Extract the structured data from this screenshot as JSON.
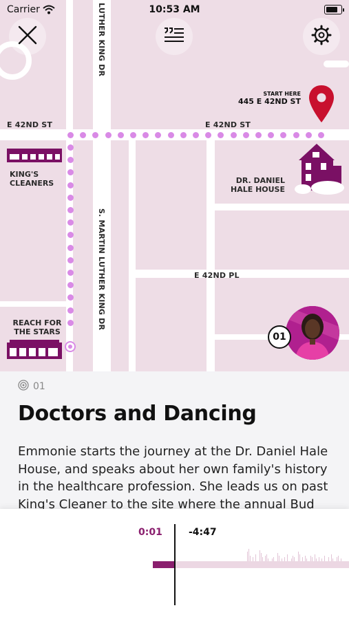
{
  "status_bar": {
    "carrier": "Carrier",
    "time": "10:53 AM"
  },
  "map": {
    "streets": {
      "e42nd_st_left": "E 42ND ST",
      "e42nd_st_right": "E 42ND ST",
      "luther_king_dr": "LUTHER KING DR",
      "s_martin_luther_king_dr": "S. MARTIN LUTHER KING DR",
      "e42nd_pl": "E 42ND PL"
    },
    "start": {
      "label": "START HERE",
      "address": "445 E 42ND ST"
    },
    "places": {
      "kings_cleaners": "KING'S CLEANERS",
      "hale_house": "DR. DANIEL HALE HOUSE",
      "reach_for_stars": "REACH FOR THE STARS"
    },
    "stop_badge": "01",
    "route_color": "#d98ae6",
    "pin_color": "#c8102e"
  },
  "buttons": {
    "close": "close-icon",
    "transcript": "transcript-icon",
    "settings": "gear-icon"
  },
  "stop": {
    "number": "01",
    "title": "Doctors and Dancing",
    "description": "Emmonie starts the journey at the Dr. Daniel Hale House, and speaks about her own family's history in the healthcare profession. She leads us on past King's Cleaner to the site where the annual Bud"
  },
  "player": {
    "elapsed": "0:01",
    "remaining": "-4:47",
    "accent": "#8a1f6e"
  }
}
